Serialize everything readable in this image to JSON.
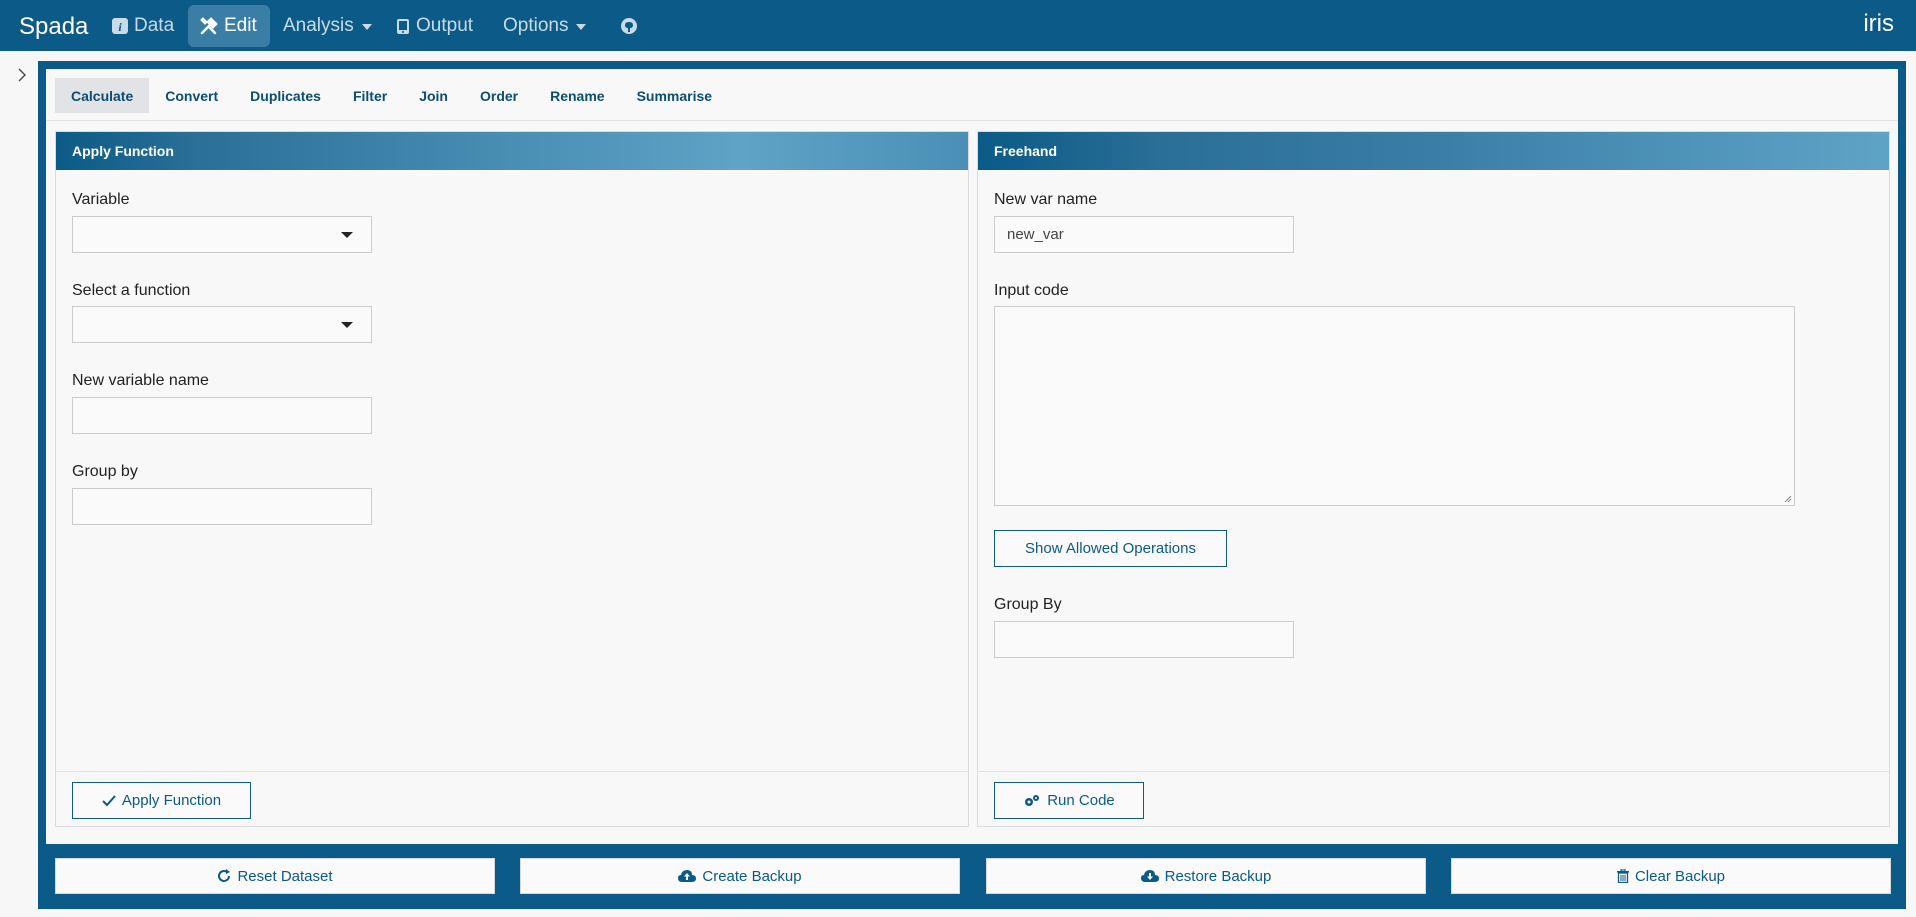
{
  "navbar": {
    "brand": "Spada",
    "items": [
      {
        "label": "Data",
        "icon": "info-icon"
      },
      {
        "label": "Edit",
        "icon": "tools-icon",
        "active": true
      },
      {
        "label": "Analysis",
        "icon": "",
        "dropdown": true
      },
      {
        "label": "Output",
        "icon": "tablet-icon"
      },
      {
        "label": "Options",
        "icon": "",
        "dropdown": true
      },
      {
        "label": "",
        "icon": "github-icon"
      }
    ],
    "dataset": "iris"
  },
  "tabs": [
    {
      "label": "Calculate",
      "active": true
    },
    {
      "label": "Convert"
    },
    {
      "label": "Duplicates"
    },
    {
      "label": "Filter"
    },
    {
      "label": "Join"
    },
    {
      "label": "Order"
    },
    {
      "label": "Rename"
    },
    {
      "label": "Summarise"
    }
  ],
  "apply_function": {
    "title": "Apply Function",
    "variable_label": "Variable",
    "variable_value": "",
    "function_label": "Select a function",
    "function_value": "",
    "new_var_label": "New variable name",
    "new_var_value": "",
    "group_by_label": "Group by",
    "group_by_value": "",
    "apply_button": "Apply Function"
  },
  "freehand": {
    "title": "Freehand",
    "new_var_label": "New var name",
    "new_var_value": "new_var",
    "input_code_label": "Input code",
    "input_code_value": "",
    "show_ops_button": "Show Allowed Operations",
    "group_by_label": "Group By",
    "group_by_value": "",
    "run_button": "Run Code"
  },
  "bottom_buttons": {
    "reset": "Reset Dataset",
    "create_backup": "Create Backup",
    "restore_backup": "Restore Backup",
    "clear_backup": "Clear Backup"
  },
  "colors": {
    "navbar_bg": "#0b5a87",
    "accent": "#0b5a87",
    "panel_gradient": [
      "#0b5a87",
      "#5fa4c7"
    ]
  }
}
